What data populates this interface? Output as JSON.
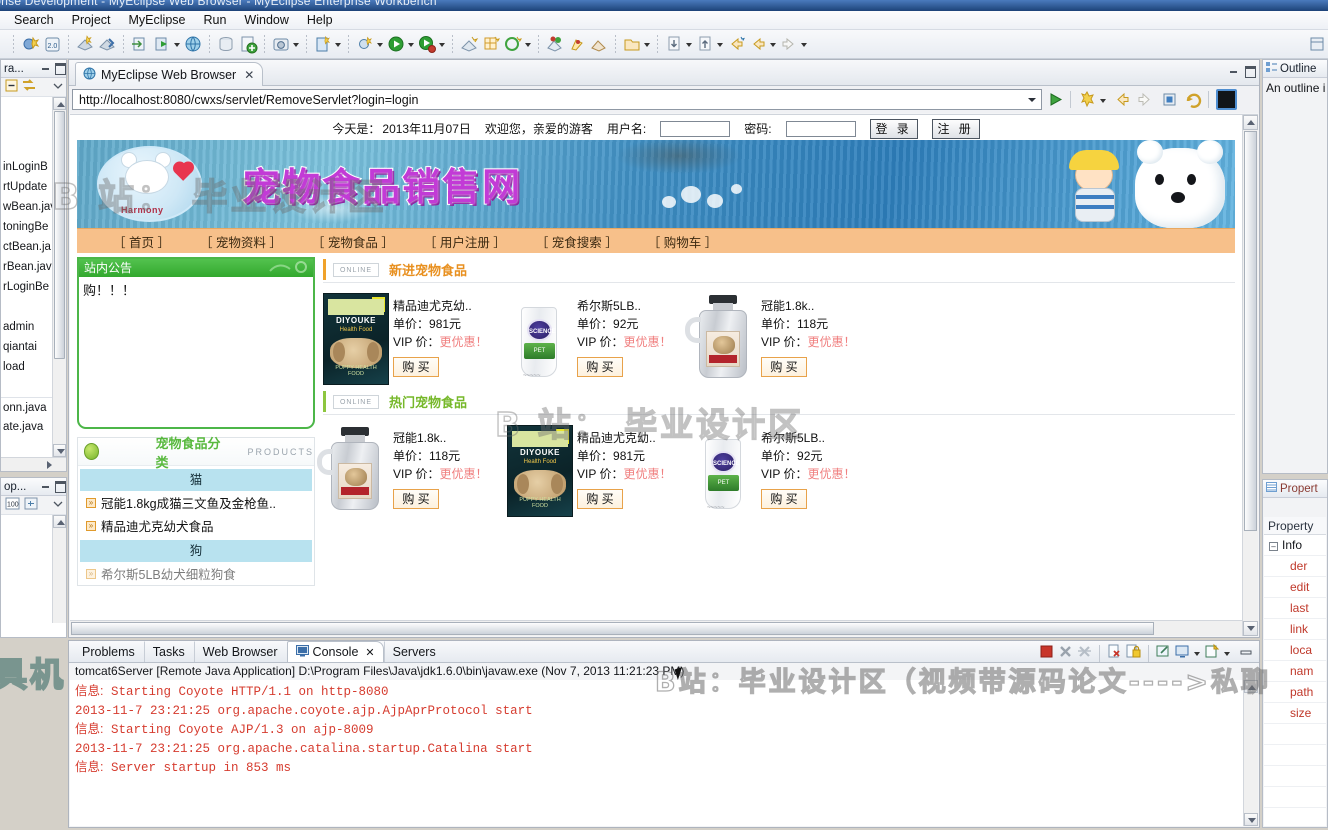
{
  "window": {
    "title": "rprise Development - MyEclipse Web Browser - MyEclipse Enterprise Workbench"
  },
  "menubar": {
    "items": [
      "Search",
      "Project",
      "MyEclipse",
      "Run",
      "Window",
      "Help"
    ]
  },
  "left_dock": {
    "explorer": {
      "tab_label": "ra...",
      "tree_rows": [
        "inLoginB",
        "rtUpdate",
        "wBean.jav",
        "toningBe",
        "ctBean.ja",
        "rBean.jav",
        "rLoginBe",
        "",
        "admin",
        "qiantai",
        "load",
        "",
        "onn.java",
        "ate.java"
      ]
    },
    "lower_panel": {
      "tab_label": "op..."
    }
  },
  "editor": {
    "tab_label": "MyEclipse Web Browser",
    "tab_close": "✕",
    "url": "http://localhost:8080/cwxs/servlet/RemoveServlet?login=login"
  },
  "webpage": {
    "topbar": {
      "today_label": "今天是：",
      "today_value": "2013年11月07日",
      "welcome": "欢迎您，亲爱的游客",
      "username_label": "用户名:",
      "username_value": "",
      "password_label": "密码:",
      "password_value": "",
      "login_button": "登 录",
      "register_button": "注 册"
    },
    "banner": {
      "site_title": "宠物食品销售网",
      "logo_word": "Harmony"
    },
    "nav": [
      "［ 首页 ］",
      "［ 宠物资料 ］",
      "［ 宠物食品 ］",
      "［ 用户注册 ］",
      "［ 宠食搜索 ］",
      "［ 购物车 ］"
    ],
    "notice": {
      "header": "站内公告",
      "body": "购！！！"
    },
    "category": {
      "title": "宠物食品分类",
      "subtitle": "PRODUCTS",
      "groups": [
        {
          "name": "猫",
          "items": [
            "冠能1.8kg成猫三文鱼及金枪鱼..",
            "精品迪尤克幼犬食品"
          ]
        },
        {
          "name": "狗",
          "items": [
            "希尔斯5LB幼犬细粒狗食"
          ]
        }
      ]
    },
    "sections": [
      {
        "badge": "ONLINE",
        "title": "新进宠物食品",
        "products": [
          {
            "name": "精品迪尤克幼..",
            "price_label": "单价：",
            "price": "981元",
            "vip_label": "VIP 价：",
            "vip_value": "更优惠！",
            "buy": "购 买",
            "img": "bag"
          },
          {
            "name": "希尔斯5LB..",
            "price_label": "单价：",
            "price": "92元",
            "vip_label": "VIP 价：",
            "vip_value": "更优惠！",
            "buy": "购 买",
            "img": "can"
          },
          {
            "name": "冠能1.8k..",
            "price_label": "单价：",
            "price": "118元",
            "vip_label": "VIP 价：",
            "vip_value": "更优惠！",
            "buy": "购 买",
            "img": "bottle"
          }
        ]
      },
      {
        "badge": "ONLINE",
        "title": "热门宠物食品",
        "products": [
          {
            "name": "冠能1.8k..",
            "price_label": "单价：",
            "price": "118元",
            "vip_label": "VIP 价：",
            "vip_value": "更优惠！",
            "buy": "购 买",
            "img": "bottle"
          },
          {
            "name": "精品迪尤克幼..",
            "price_label": "单价：",
            "price": "981元",
            "vip_label": "VIP 价：",
            "vip_value": "更优惠！",
            "buy": "购 买",
            "img": "bag"
          },
          {
            "name": "希尔斯5LB..",
            "price_label": "单价：",
            "price": "92元",
            "vip_label": "VIP 价：",
            "vip_value": "更优惠！",
            "buy": "购 买",
            "img": "can"
          }
        ]
      }
    ]
  },
  "bottom_panel": {
    "tabs": [
      "Problems",
      "Tasks",
      "Web Browser",
      "Console",
      "Servers"
    ],
    "active_tab": "Console",
    "tab_close": "✕",
    "launch_line": "tomcat6Server [Remote Java Application] D:\\Program Files\\Java\\jdk1.6.0\\bin\\javaw.exe (Nov 7, 2013 11:21:23 PM)",
    "console_lines": [
      {
        "prefix": "信息:",
        "text": " Starting Coyote HTTP/1.1 on http-8080"
      },
      {
        "prefix": "",
        "text": "2013-11-7 23:21:25 org.apache.coyote.ajp.AjpAprProtocol start"
      },
      {
        "prefix": "信息:",
        "text": " Starting Coyote AJP/1.3 on ajp-8009"
      },
      {
        "prefix": "",
        "text": "2013-11-7 23:21:25 org.apache.catalina.startup.Catalina start"
      },
      {
        "prefix": "信息:",
        "text": " Server startup in 853 ms"
      }
    ]
  },
  "right_dock": {
    "outline": {
      "tab_label": "Outline",
      "message": "An outline i"
    },
    "properties": {
      "tab_label": "Propert",
      "column_header": "Property",
      "group": "Info",
      "rows": [
        "der",
        "edit",
        "last",
        "link",
        "loca",
        "nam",
        "path",
        "size"
      ]
    }
  },
  "watermarks": {
    "w1": "B 站：  毕业设计区",
    "w2": "B 站：  毕业设计区",
    "w3": "B站：毕业设计区（视频带源码论文---->私聊",
    "w4": "具机"
  },
  "colors": {
    "accent_orange": "#e89020",
    "accent_green": "#76b82a",
    "title_purple": "#c23bd6",
    "nav_bg": "#f7c08a",
    "console_red": "#d63c2f"
  }
}
